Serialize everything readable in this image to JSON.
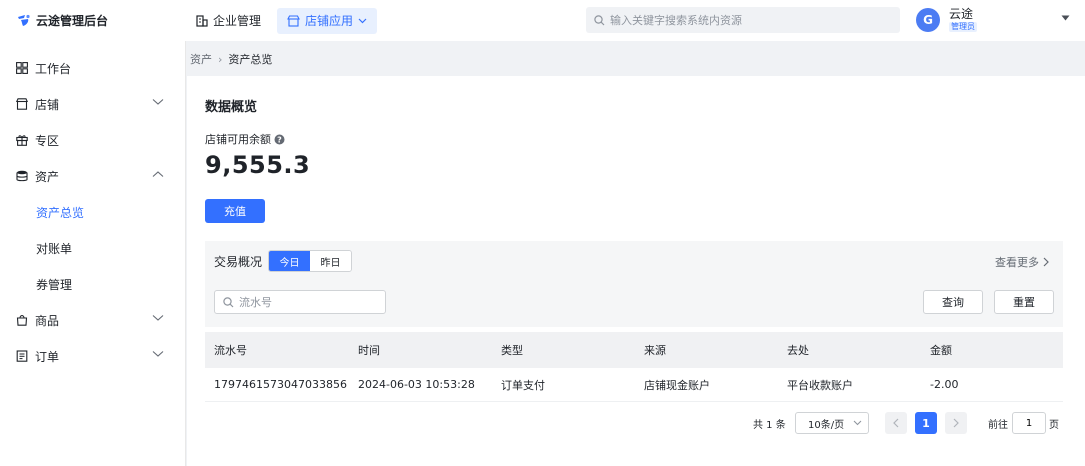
{
  "brand": {
    "name": "云途管理后台",
    "accent": "#3370ff"
  },
  "topnav": {
    "items": [
      {
        "label": "企业管理",
        "icon": "building-icon"
      },
      {
        "label": "店铺应用",
        "icon": "store-icon"
      }
    ]
  },
  "search": {
    "placeholder": "输入关键字搜索系统内资源"
  },
  "user": {
    "avatar_letter": "G",
    "name": "云途",
    "role": "管理员"
  },
  "sidebar": {
    "items": [
      {
        "label": "工作台",
        "icon": "dashboard-icon"
      },
      {
        "label": "店铺",
        "icon": "shop-icon"
      },
      {
        "label": "专区",
        "icon": "gift-icon"
      },
      {
        "label": "资产",
        "icon": "database-icon"
      },
      {
        "label": "资产总览"
      },
      {
        "label": "对账单"
      },
      {
        "label": "券管理"
      },
      {
        "label": "商品",
        "icon": "bag-icon"
      },
      {
        "label": "订单",
        "icon": "order-icon"
      }
    ]
  },
  "breadcrumb": {
    "parent": "资产",
    "current": "资产总览"
  },
  "overview": {
    "title": "数据概览",
    "balance_label": "店铺可用余额",
    "balance_value": "9,555.3",
    "recharge_label": "充值"
  },
  "transactions": {
    "title": "交易概况",
    "tabs": [
      "今日",
      "昨日"
    ],
    "more_label": "查看更多",
    "filter_placeholder": "流水号",
    "query_label": "查询",
    "reset_label": "重置",
    "columns": [
      "流水号",
      "时间",
      "类型",
      "来源",
      "去处",
      "金额"
    ],
    "rows": [
      [
        "1797461573047033856",
        "2024-06-03 10:53:28",
        "订单支付",
        "店铺现金账户",
        "平台收款账户",
        "-2.00"
      ]
    ]
  },
  "pagination": {
    "total_label": "共 1 条",
    "page_size_label": "10条/页",
    "current_page": "1",
    "goto_label": "前往",
    "goto_value": "1",
    "page_suffix": "页"
  }
}
